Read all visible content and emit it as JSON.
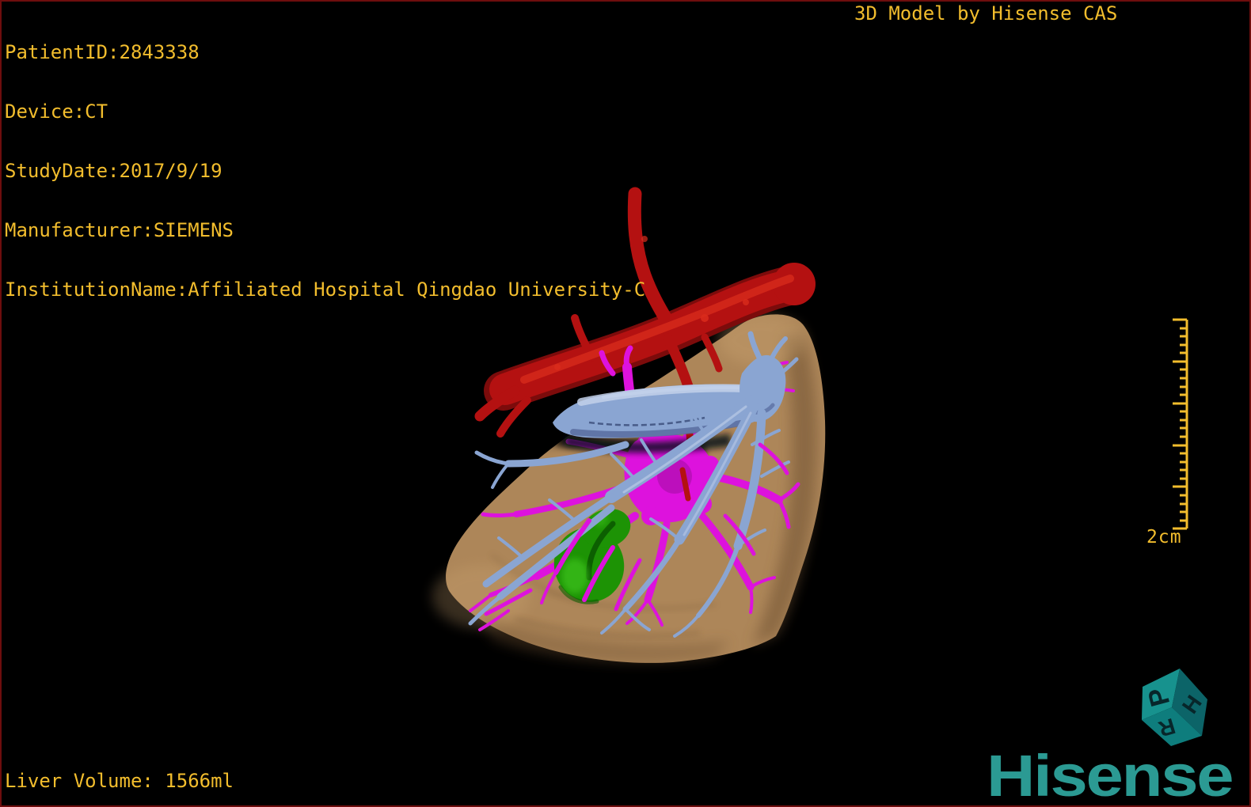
{
  "overlay": {
    "patient_info_lines": [
      "PatientID:2843338",
      "Device:CT",
      "StudyDate:2017/9/19",
      "Manufacturer:SIEMENS",
      "InstitutionName:Affiliated Hospital Qingdao University-C"
    ],
    "title": "3D Model by Hisense CAS",
    "liver_volume": "Liver Volume: 1566ml",
    "scale_label": "2cm",
    "brand": "Hisense",
    "orientation_cube": {
      "posterior": "P",
      "head": "H",
      "right": "R"
    }
  },
  "colors": {
    "background": "#000000",
    "frame_border": "#6e0d0d",
    "annotation_text": "#f2bd2d",
    "brand_teal": "#2b9a93",
    "cube_top": "#17928e",
    "cube_right": "#0c6468",
    "cube_front": "#0e7d7d",
    "cube_letter": "#07262a",
    "liver": "#ad8659",
    "liver_shadow": "#6f5133",
    "liver_highlight": "#cca572",
    "hepatic_artery": "#b41111",
    "artery_dark": "#7c0b0b",
    "artery_highlight": "#da2c1c",
    "portal_vein": "#8aa5d2",
    "vein_highlight": "#c2d0ea",
    "vein_shadow": "#55699c",
    "hepatic_vein": "#dd12dd",
    "hepatic_vein_dark": "#9c0b9c",
    "tumor": "#1d9305",
    "tumor_highlight": "#3ec31b",
    "tumor_dark": "#0b5a01"
  }
}
